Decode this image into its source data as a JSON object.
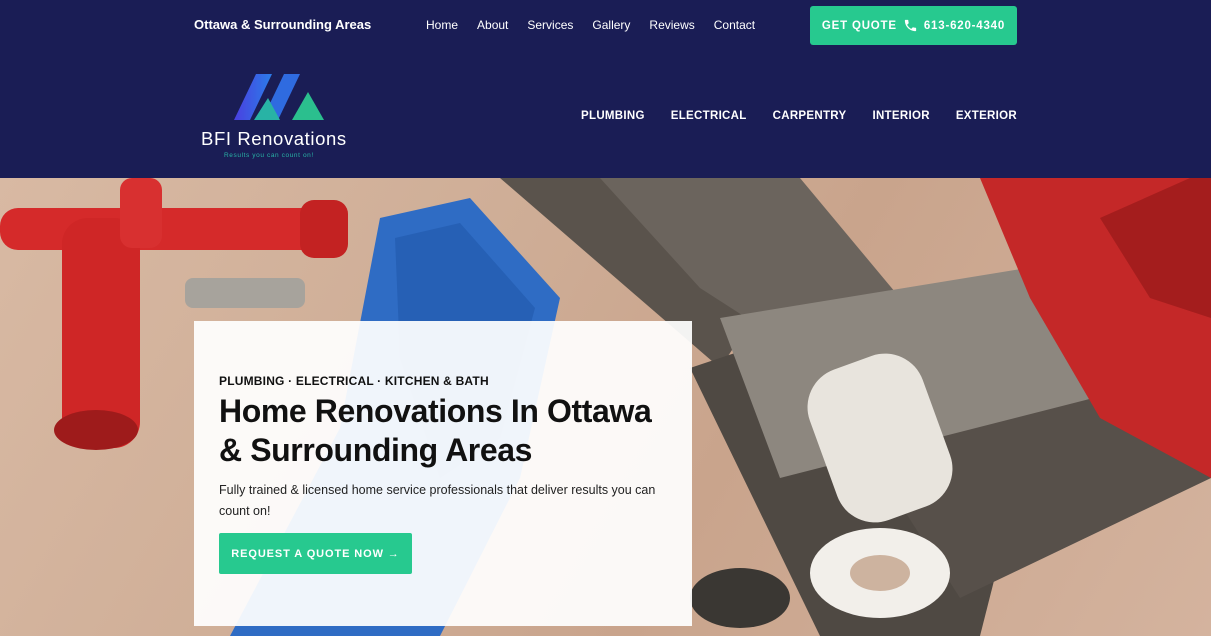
{
  "topbar": {
    "region": "Ottawa & Surrounding Areas",
    "nav": [
      "Home",
      "About",
      "Services",
      "Gallery",
      "Reviews",
      "Contact"
    ],
    "quote_label": "GET QUOTE",
    "phone": "613-620-4340"
  },
  "logo": {
    "name": "BFI Renovations",
    "tagline": "Results you can count on!"
  },
  "mainnav": [
    "PLUMBING",
    "ELECTRICAL",
    "CARPENTRY",
    "INTERIOR",
    "EXTERIOR"
  ],
  "hero": {
    "eyebrow": "PLUMBING · ELECTRICAL · KITCHEN & BATH",
    "headline": "Home Renovations In Ottawa & Surrounding Areas",
    "intro": "Fully trained & licensed home service professionals that deliver results you can count on!",
    "cta": "REQUEST A QUOTE NOW →"
  },
  "colors": {
    "navy": "#1a1d55",
    "accent_green": "#27c98f",
    "logo_blue": "#3b5bdb",
    "logo_teal": "#28b3a5"
  }
}
